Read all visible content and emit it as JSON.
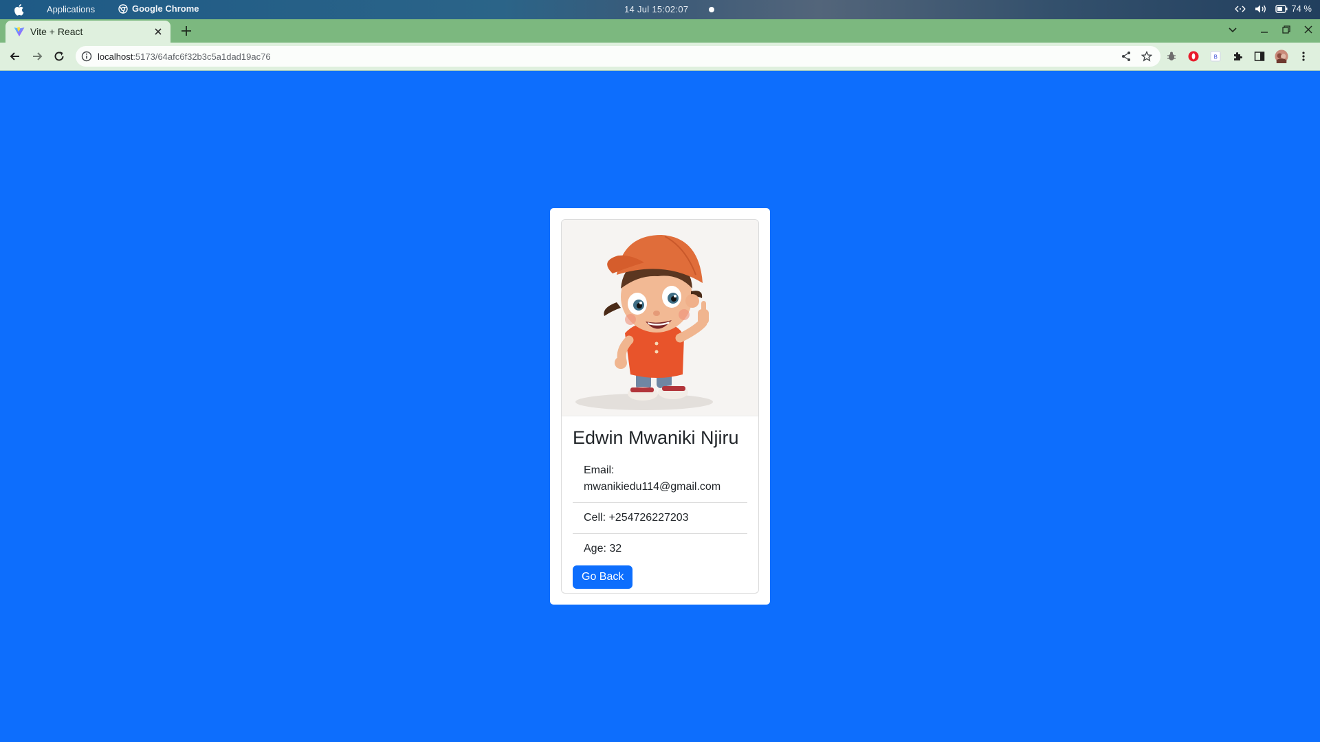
{
  "os_bar": {
    "applications_label": "Applications",
    "active_app_label": "Google Chrome",
    "clock": "14 Jul  15:02:07",
    "battery": "74 %"
  },
  "browser": {
    "tab_title": "Vite + React",
    "url_host": "localhost",
    "url_path": ":5173/64afc6f32b3c5a1dad19ac76"
  },
  "colors": {
    "page_background": "#0d6efd",
    "tab_strip": "#7cb87f",
    "toolbar": "#dff0de",
    "button_primary": "#0d6efd"
  },
  "profile": {
    "name": "Edwin Mwaniki Njiru",
    "email_label": "Email:",
    "email": "mwanikiedu114@gmail.com",
    "cell": "Cell: +254726227203",
    "age": "Age: 32",
    "go_back_label": "Go Back",
    "image": "cartoon-boy-avatar"
  }
}
